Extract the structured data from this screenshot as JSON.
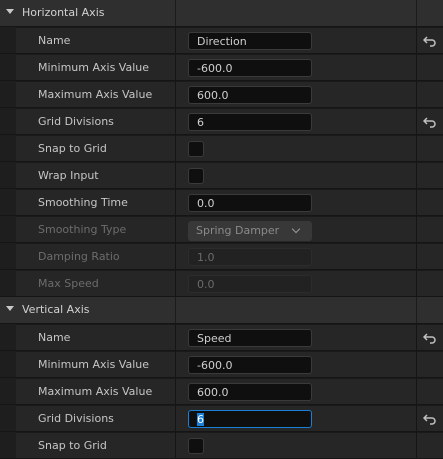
{
  "horizontal": {
    "title": "Horizontal Axis",
    "name_label": "Name",
    "name_value": "Direction",
    "min_label": "Minimum Axis Value",
    "min_value": "-600.0",
    "max_label": "Maximum Axis Value",
    "max_value": "600.0",
    "grid_label": "Grid Divisions",
    "grid_value": "6",
    "snap_label": "Snap to Grid",
    "wrap_label": "Wrap Input",
    "smoothing_label": "Smoothing Time",
    "smoothing_value": "0.0",
    "smoothing_type_label": "Smoothing Type",
    "smoothing_type_value": "Spring Damper",
    "damping_label": "Damping Ratio",
    "damping_value": "1.0",
    "maxspeed_label": "Max Speed",
    "maxspeed_value": "0.0"
  },
  "vertical": {
    "title": "Vertical Axis",
    "name_label": "Name",
    "name_value": "Speed",
    "min_label": "Minimum Axis Value",
    "min_value": "-600.0",
    "max_label": "Maximum Axis Value",
    "max_value": "600.0",
    "grid_label": "Grid Divisions",
    "grid_value": "6",
    "snap_label": "Snap to Grid"
  },
  "icons": {
    "reset": "reset-to-default-icon",
    "collapse": "caret-down-icon"
  }
}
